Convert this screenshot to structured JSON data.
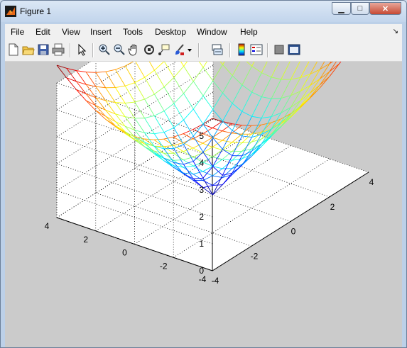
{
  "window": {
    "title": "Figure 1",
    "controls": {
      "minimize": "▁",
      "maximize": "□",
      "close": "✕"
    }
  },
  "menu": {
    "items": [
      "File",
      "Edit",
      "View",
      "Insert",
      "Tools",
      "Desktop",
      "Window",
      "Help"
    ],
    "dock_arrow": "↘"
  },
  "toolbar": {
    "icons": [
      "new-figure-icon",
      "open-file-icon",
      "save-icon",
      "print-icon",
      "edit-plot-arrow-icon",
      "zoom-in-icon",
      "zoom-out-icon",
      "pan-hand-icon",
      "rotate-3d-icon",
      "data-cursor-icon",
      "brush-icon",
      "brush-dropdown-icon",
      "link-plot-icon",
      "insert-colorbar-icon",
      "insert-legend-icon",
      "hide-plot-tools-icon",
      "show-plot-tools-icon"
    ]
  },
  "chart_data": {
    "type": "surface",
    "title": "",
    "function": "sqrt(x^2 + y^2)",
    "x": [
      -4,
      -3.5,
      -3,
      -2.5,
      -2,
      -1.5,
      -1,
      -0.5,
      0,
      0.5,
      1,
      1.5,
      2,
      2.5,
      3,
      3.5,
      4
    ],
    "y": [
      -4,
      -3.5,
      -3,
      -2.5,
      -2,
      -1.5,
      -1,
      -0.5,
      0,
      0.5,
      1,
      1.5,
      2,
      2.5,
      3,
      3.5,
      4
    ],
    "xlim": [
      -4,
      4
    ],
    "ylim": [
      -4,
      4
    ],
    "zlim": [
      0,
      5
    ],
    "x_ticks": [
      "-4",
      "-2",
      "0",
      "2",
      "4"
    ],
    "y_ticks": [
      "-4",
      "-2",
      "0",
      "2",
      "4"
    ],
    "z_ticks": [
      "0",
      "1",
      "2",
      "3",
      "4",
      "5"
    ],
    "colormap": "jet",
    "grid": true,
    "colors": {
      "axes_background": "#ffffff",
      "figure_background": "#cbcbcb"
    }
  }
}
